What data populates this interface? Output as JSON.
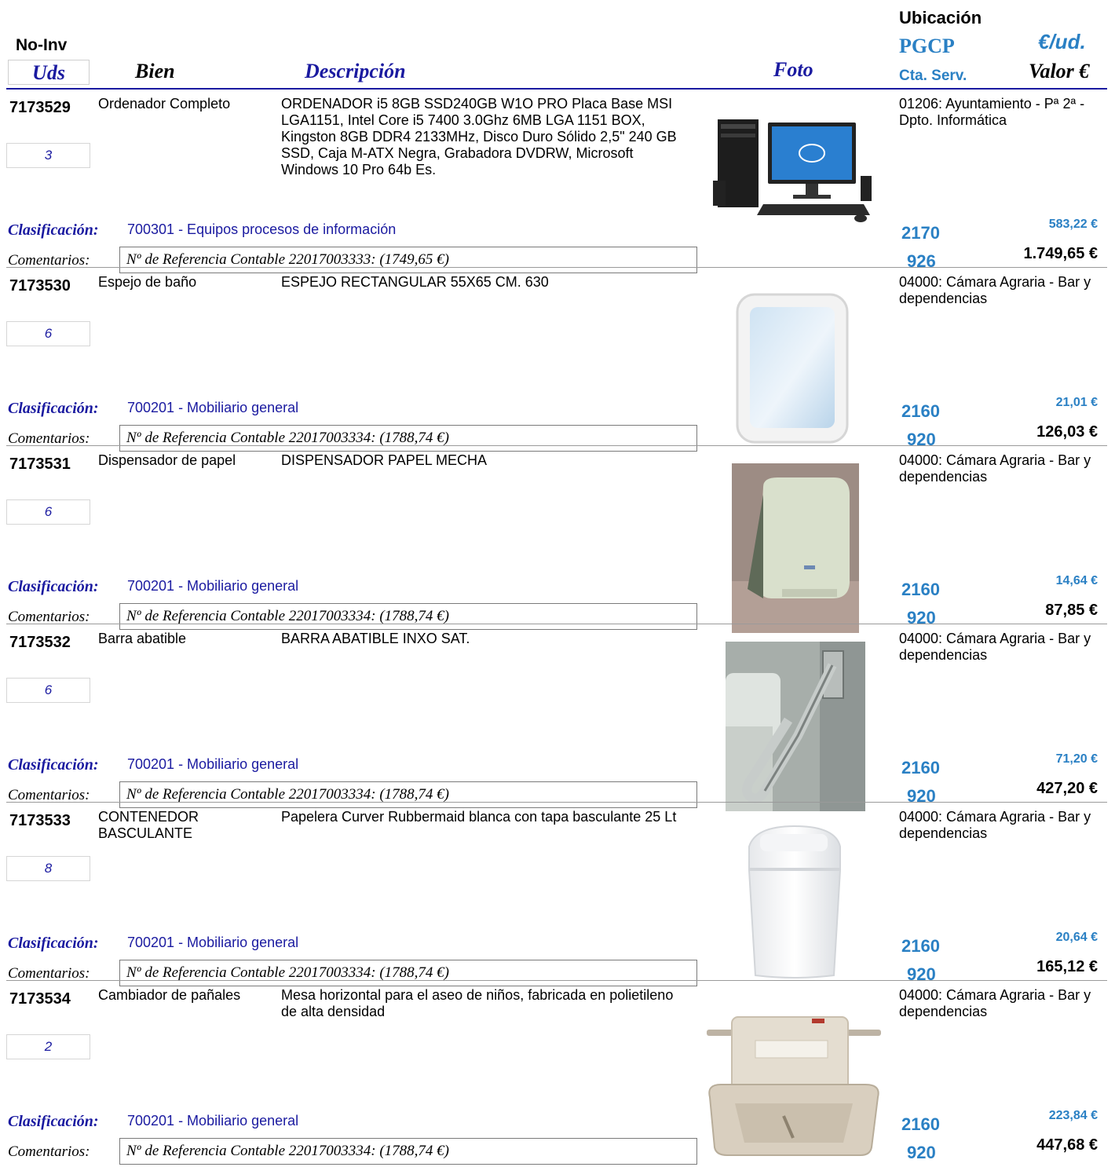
{
  "header": {
    "no_inv": "No-Inv",
    "uds": "Uds",
    "bien": "Bien",
    "descripcion": "Descripción",
    "foto": "Foto",
    "ubicacion": "Ubicación",
    "pgcp": "PGCP",
    "eur_ud": "€/ud.",
    "cta_serv": "Cta. Serv.",
    "valor": "Valor €"
  },
  "labels": {
    "clasificacion": "Clasificación:",
    "comentarios": "Comentarios:"
  },
  "items": [
    {
      "inv": "7173529",
      "uds": "3",
      "bien": "Ordenador Completo",
      "descripcion": "ORDENADOR i5 8GB SSD240GB W1O PRO Placa Base MSI LGA1151, Intel Core i5 7400 3.0Ghz 6MB LGA 1151 BOX, Kingston 8GB DDR4 2133MHz, Disco Duro Sólido 2,5\" 240 GB SSD, Caja M-ATX Negra, Grabadora DVDRW, Microsoft Windows 10 Pro 64b Es.",
      "clasificacion": "700301 - Equipos procesos de información",
      "comentario": "Nº de Referencia Contable 22017003333:  (1749,65 €)",
      "ubicacion": "01206: Ayuntamiento - Pª 2ª - Dpto. Informática",
      "pgcp": "2170",
      "cta_serv": "926",
      "eur_ud": "583,22 €",
      "valor": "1.749,65 €",
      "foto_icon": "computer-photo"
    },
    {
      "inv": "7173530",
      "uds": "6",
      "bien": "Espejo de baño",
      "descripcion": "ESPEJO RECTANGULAR 55X65 CM. 630",
      "clasificacion": "700201 - Mobiliario general",
      "comentario": "Nº de Referencia Contable 22017003334:  (1788,74 €)",
      "ubicacion": "04000: Cámara Agraria - Bar y dependencias",
      "pgcp": "2160",
      "cta_serv": "920",
      "eur_ud": "21,01 €",
      "valor": "126,03 €",
      "foto_icon": "mirror-photo"
    },
    {
      "inv": "7173531",
      "uds": "6",
      "bien": "Dispensador de papel",
      "descripcion": "DISPENSADOR PAPEL MECHA",
      "clasificacion": "700201 - Mobiliario general",
      "comentario": "Nº de Referencia Contable 22017003334:  (1788,74 €)",
      "ubicacion": "04000: Cámara Agraria - Bar y dependencias",
      "pgcp": "2160",
      "cta_serv": "920",
      "eur_ud": "14,64 €",
      "valor": "87,85 €",
      "foto_icon": "paper-dispenser-photo"
    },
    {
      "inv": "7173532",
      "uds": "6",
      "bien": "Barra abatible",
      "descripcion": "BARRA ABATIBLE INXO SAT.",
      "clasificacion": "700201 - Mobiliario general",
      "comentario": "Nº de Referencia Contable 22017003334:  (1788,74 €)",
      "ubicacion": "04000: Cámara Agraria - Bar y dependencias",
      "pgcp": "2160",
      "cta_serv": "920",
      "eur_ud": "71,20 €",
      "valor": "427,20 €",
      "foto_icon": "grab-bar-photo"
    },
    {
      "inv": "7173533",
      "uds": "8",
      "bien": "CONTENEDOR BASCULANTE",
      "descripcion": "Papelera Curver Rubbermaid blanca con tapa basculante 25 Lt",
      "clasificacion": "700201 - Mobiliario general",
      "comentario": "Nº de Referencia Contable 22017003334:  (1788,74 €)",
      "ubicacion": "04000: Cámara Agraria - Bar y dependencias",
      "pgcp": "2160",
      "cta_serv": "920",
      "eur_ud": "20,64 €",
      "valor": "165,12 €",
      "foto_icon": "bin-photo"
    },
    {
      "inv": "7173534",
      "uds": "2",
      "bien": "Cambiador de pañales",
      "descripcion": "Mesa horizontal para el aseo de niños, fabricada en polietileno de alta densidad",
      "clasificacion": "700201 - Mobiliario general",
      "comentario": "Nº de Referencia Contable 22017003334:  (1788,74 €)",
      "ubicacion": "04000: Cámara Agraria - Bar y dependencias",
      "pgcp": "2160",
      "cta_serv": "920",
      "eur_ud": "223,84 €",
      "valor": "447,68 €",
      "foto_icon": "changing-table-photo"
    }
  ]
}
